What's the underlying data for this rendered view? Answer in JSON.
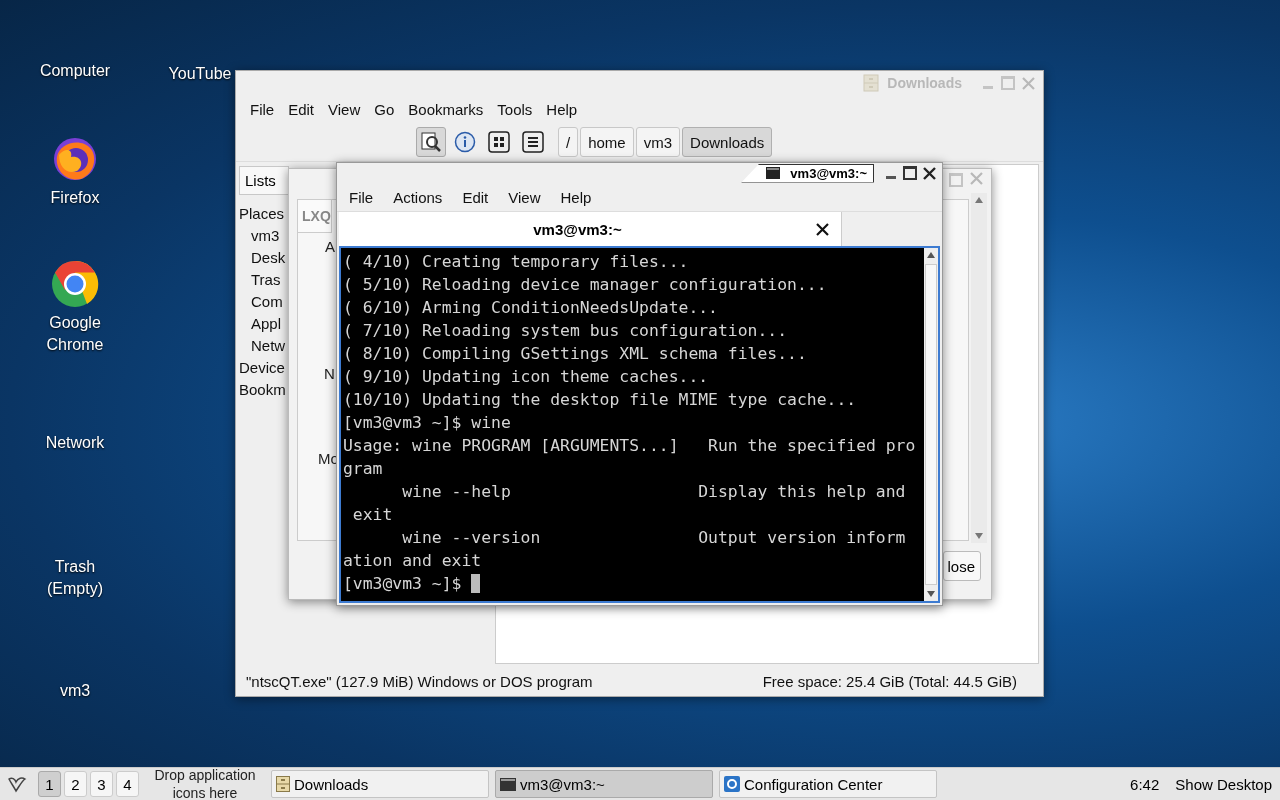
{
  "desktop_icons": [
    {
      "label": "Computer",
      "kind": "plain"
    },
    {
      "label": "YouTube",
      "kind": "plain"
    },
    {
      "label": "Firefox",
      "kind": "firefox"
    },
    {
      "label": "Google Chrome",
      "kind": "chrome"
    },
    {
      "label": "Network",
      "kind": "plain"
    },
    {
      "label": "Trash (Empty)",
      "kind": "plain"
    },
    {
      "label": "vm3",
      "kind": "plain"
    }
  ],
  "file_manager": {
    "title": "Downloads",
    "menu": [
      "File",
      "Edit",
      "View",
      "Go",
      "Bookmarks",
      "Tools",
      "Help"
    ],
    "path": [
      {
        "label": "/",
        "selected": false
      },
      {
        "label": "home",
        "selected": false
      },
      {
        "label": "vm3",
        "selected": false
      },
      {
        "label": "Downloads",
        "selected": true
      }
    ],
    "side_pane": {
      "list_mode": "Lists",
      "tree": [
        {
          "label": "Places",
          "children": [
            {
              "label": "vm3"
            },
            {
              "label": "Desk"
            },
            {
              "label": "Tras"
            },
            {
              "label": "Com"
            },
            {
              "label": "Appl"
            },
            {
              "label": "Netw"
            }
          ]
        },
        {
          "label": "Device"
        },
        {
          "label": "Bookm"
        }
      ]
    },
    "status_left": "\"ntscQT.exe\" (127.9 MiB) Windows or DOS program",
    "status_right": "Free space: 25.4 GiB (Total: 44.5 GiB)"
  },
  "config_dialog": {
    "tab": "LXQ",
    "fragments": [
      "A",
      "N",
      "Mo"
    ],
    "button": "lose"
  },
  "terminal": {
    "title": "vm3@vm3:~",
    "menu": [
      "File",
      "Actions",
      "Edit",
      "View",
      "Help"
    ],
    "tab": "vm3@vm3:~",
    "lines": [
      "( 4/10) Creating temporary files...",
      "( 5/10) Reloading device manager configuration...",
      "( 6/10) Arming ConditionNeedsUpdate...",
      "( 7/10) Reloading system bus configuration...",
      "( 8/10) Compiling GSettings XML schema files...",
      "( 9/10) Updating icon theme caches...",
      "(10/10) Updating the desktop file MIME type cache...",
      "[vm3@vm3 ~]$ wine",
      "Usage: wine PROGRAM [ARGUMENTS...]   Run the specified pro",
      "gram",
      "      wine --help                   Display this help and",
      " exit",
      "      wine --version                Output version inform",
      "ation and exit"
    ],
    "prompt": "[vm3@vm3 ~]$ "
  },
  "taskbar": {
    "desktops": [
      {
        "label": "1",
        "selected": true
      },
      {
        "label": "2",
        "selected": false
      },
      {
        "label": "3",
        "selected": false
      },
      {
        "label": "4",
        "selected": false
      }
    ],
    "quicklaunch_hint": "Drop application icons here",
    "tasks": [
      {
        "label": "Downloads",
        "kind": "files",
        "active": false
      },
      {
        "label": "vm3@vm3:~",
        "kind": "terminal",
        "active": true
      },
      {
        "label": "Configuration Center",
        "kind": "config",
        "active": false
      }
    ],
    "clock": "6:42",
    "show_desktop": "Show Desktop"
  }
}
